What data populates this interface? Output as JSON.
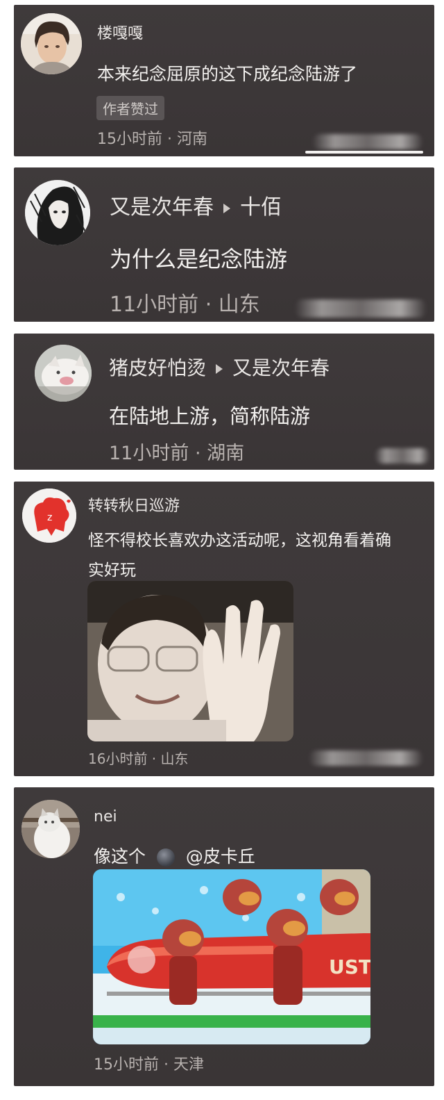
{
  "comments": [
    {
      "author": "楼嘎嘎",
      "text": "本来纪念屈原的这下成纪念陆游了",
      "badge": "作者赞过",
      "meta": "15小时前 · 河南"
    },
    {
      "author": "又是次年春",
      "reply_to": "十佰",
      "text": "为什么是纪念陆游",
      "meta": "11小时前 · 山东"
    },
    {
      "author": "猪皮好怕烫",
      "reply_to": "又是次年春",
      "text": "在陆地上游，简称陆游",
      "meta": "11小时前 · 湖南"
    },
    {
      "author": "转转秋日巡游",
      "text_line1": "怪不得校长喜欢办这活动呢，这视角看着确",
      "text_line2": "实好玩",
      "meta": "16小时前 · 山东"
    },
    {
      "author": "nei",
      "text": "像这个",
      "mention": "@皮卡丘",
      "meta": "15小时前 · 天津",
      "image_sign": "UST"
    }
  ],
  "colors": {
    "card_bg": "#3c3738",
    "text": "#f3f1ef",
    "meta": "#b9b3b0"
  }
}
